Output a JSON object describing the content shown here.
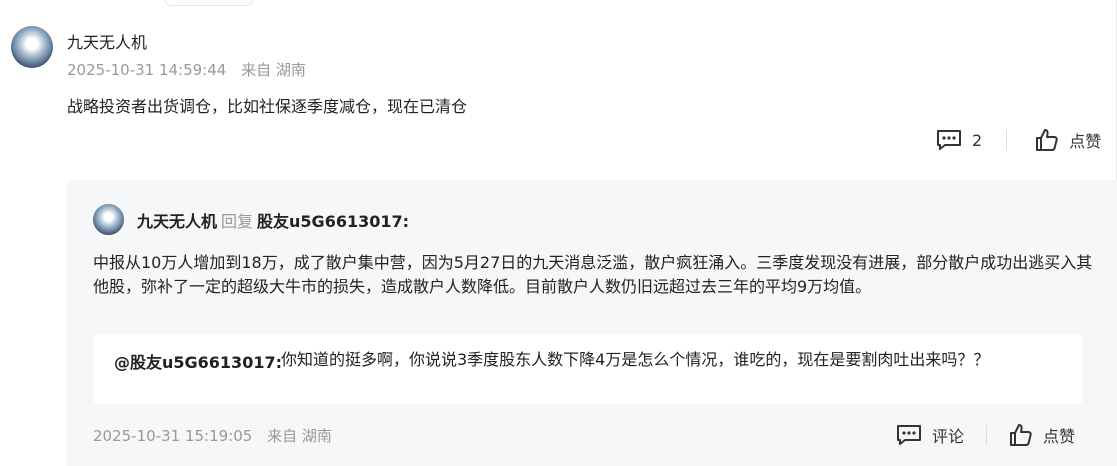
{
  "comment": {
    "author": "九天无人机",
    "timestamp": "2025-10-31 14:59:44",
    "location": "来自 湖南",
    "content": "战略投资者出货调仓，比如社保逐季度减仓，现在已清仓",
    "comment_count": "2",
    "like_label": "点赞",
    "icons": [
      "comment-icon",
      "thumbs-up-icon"
    ]
  },
  "reply": {
    "author": "九天无人机",
    "reply_word": "回复",
    "target": "股友u5G6613017:",
    "content": "中报从10万人增加到18万，成了散户集中营，因为5月27日的九天消息泛滥，散户疯狂涌入。三季度发现没有进展，部分散户成功出逃买入其他股，弥补了一定的超级大牛市的损失，造成散户人数降低。目前散户人数仍旧远超过去三年的平均9万均值。",
    "quote": {
      "author": "@股友u5G6613017:",
      "text": "你知道的挺多啊，你说说3季度股东人数下降4万是怎么个情况，谁吃的，现在是要割肉吐出来吗？？"
    },
    "timestamp": "2025-10-31 15:19:05",
    "location": "来自 湖南",
    "comment_label": "评论",
    "like_label": "点赞",
    "icons": [
      "comment-icon",
      "thumbs-up-icon"
    ]
  }
}
